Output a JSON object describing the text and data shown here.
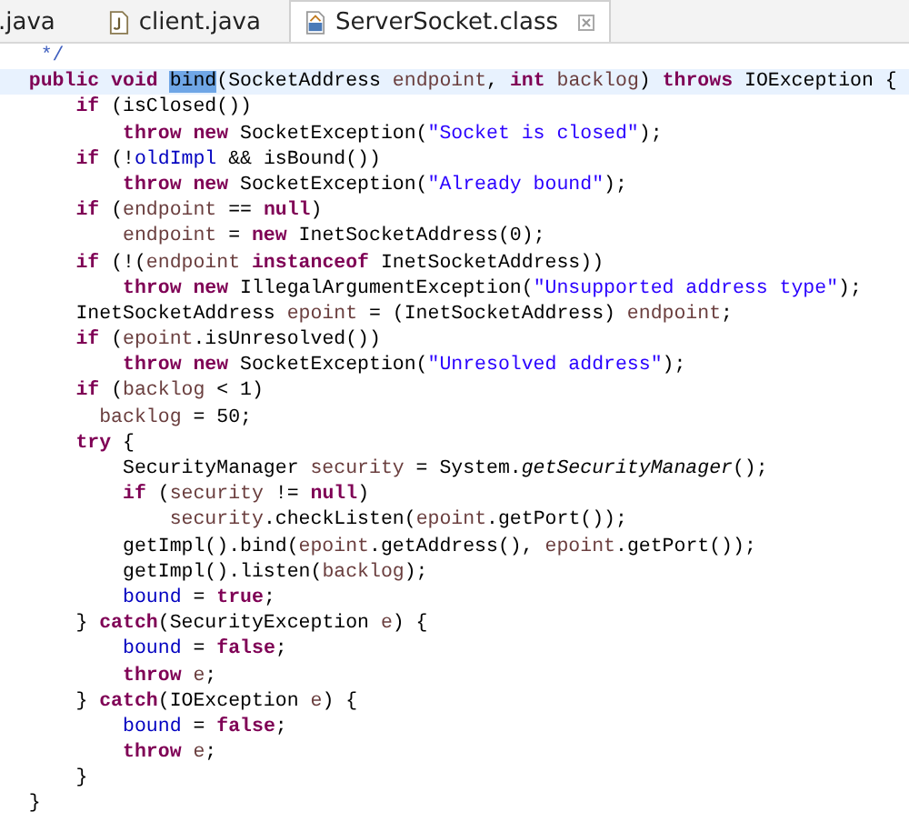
{
  "tabs": [
    {
      "label": ".java",
      "selected": false
    },
    {
      "label": "client.java",
      "kind": "java",
      "selected": false
    },
    {
      "label": "ServerSocket.class",
      "kind": "class",
      "selected": true
    }
  ],
  "code": [
    {
      "current": false,
      "segments": [
        {
          "kind": "comment",
          "text": "   */"
        }
      ]
    },
    {
      "current": true,
      "segments": [
        {
          "kind": "kw",
          "text": "  public void "
        },
        {
          "kind": "sel",
          "text": "bind"
        },
        {
          "kind": "plain",
          "text": "(SocketAddress "
        },
        {
          "kind": "var",
          "text": "endpoint"
        },
        {
          "kind": "plain",
          "text": ", "
        },
        {
          "kind": "kw",
          "text": "int "
        },
        {
          "kind": "var",
          "text": "backlog"
        },
        {
          "kind": "plain",
          "text": ") "
        },
        {
          "kind": "kw",
          "text": "throws "
        },
        {
          "kind": "plain",
          "text": "IOException {"
        }
      ]
    },
    {
      "current": false,
      "segments": [
        {
          "kind": "kw",
          "text": "      if "
        },
        {
          "kind": "plain",
          "text": "(isClosed())"
        }
      ]
    },
    {
      "current": false,
      "segments": [
        {
          "kind": "kw",
          "text": "          throw new "
        },
        {
          "kind": "plain",
          "text": "SocketException("
        },
        {
          "kind": "str",
          "text": "\"Socket is closed\""
        },
        {
          "kind": "plain",
          "text": ");"
        }
      ]
    },
    {
      "current": false,
      "segments": [
        {
          "kind": "kw",
          "text": "      if "
        },
        {
          "kind": "plain",
          "text": "(!"
        },
        {
          "kind": "field",
          "text": "oldImpl"
        },
        {
          "kind": "plain",
          "text": " && isBound())"
        }
      ]
    },
    {
      "current": false,
      "segments": [
        {
          "kind": "kw",
          "text": "          throw new "
        },
        {
          "kind": "plain",
          "text": "SocketException("
        },
        {
          "kind": "str",
          "text": "\"Already bound\""
        },
        {
          "kind": "plain",
          "text": ");"
        }
      ]
    },
    {
      "current": false,
      "segments": [
        {
          "kind": "kw",
          "text": "      if "
        },
        {
          "kind": "plain",
          "text": "("
        },
        {
          "kind": "var",
          "text": "endpoint"
        },
        {
          "kind": "plain",
          "text": " == "
        },
        {
          "kind": "kw",
          "text": "null"
        },
        {
          "kind": "plain",
          "text": ")"
        }
      ]
    },
    {
      "current": false,
      "segments": [
        {
          "kind": "var",
          "text": "          endpoint"
        },
        {
          "kind": "plain",
          "text": " = "
        },
        {
          "kind": "kw",
          "text": "new "
        },
        {
          "kind": "plain",
          "text": "InetSocketAddress(0);"
        }
      ]
    },
    {
      "current": false,
      "segments": [
        {
          "kind": "kw",
          "text": "      if "
        },
        {
          "kind": "plain",
          "text": "(!("
        },
        {
          "kind": "var",
          "text": "endpoint "
        },
        {
          "kind": "kw",
          "text": "instanceof "
        },
        {
          "kind": "plain",
          "text": "InetSocketAddress))"
        }
      ]
    },
    {
      "current": false,
      "segments": [
        {
          "kind": "kw",
          "text": "          throw new "
        },
        {
          "kind": "plain",
          "text": "IllegalArgumentException("
        },
        {
          "kind": "str",
          "text": "\"Unsupported address type\""
        },
        {
          "kind": "plain",
          "text": ");"
        }
      ]
    },
    {
      "current": false,
      "segments": [
        {
          "kind": "plain",
          "text": "      InetSocketAddress "
        },
        {
          "kind": "var",
          "text": "epoint"
        },
        {
          "kind": "plain",
          "text": " = (InetSocketAddress) "
        },
        {
          "kind": "var",
          "text": "endpoint"
        },
        {
          "kind": "plain",
          "text": ";"
        }
      ]
    },
    {
      "current": false,
      "segments": [
        {
          "kind": "kw",
          "text": "      if "
        },
        {
          "kind": "plain",
          "text": "("
        },
        {
          "kind": "var",
          "text": "epoint"
        },
        {
          "kind": "plain",
          "text": ".isUnresolved())"
        }
      ]
    },
    {
      "current": false,
      "segments": [
        {
          "kind": "kw",
          "text": "          throw new "
        },
        {
          "kind": "plain",
          "text": "SocketException("
        },
        {
          "kind": "str",
          "text": "\"Unresolved address\""
        },
        {
          "kind": "plain",
          "text": ");"
        }
      ]
    },
    {
      "current": false,
      "segments": [
        {
          "kind": "kw",
          "text": "      if "
        },
        {
          "kind": "plain",
          "text": "("
        },
        {
          "kind": "var",
          "text": "backlog"
        },
        {
          "kind": "plain",
          "text": " < 1)"
        }
      ]
    },
    {
      "current": false,
      "segments": [
        {
          "kind": "var",
          "text": "        backlog"
        },
        {
          "kind": "plain",
          "text": " = 50;"
        }
      ]
    },
    {
      "current": false,
      "segments": [
        {
          "kind": "kw",
          "text": "      try "
        },
        {
          "kind": "plain",
          "text": "{"
        }
      ]
    },
    {
      "current": false,
      "segments": [
        {
          "kind": "plain",
          "text": "          SecurityManager "
        },
        {
          "kind": "var",
          "text": "security"
        },
        {
          "kind": "plain",
          "text": " = System."
        },
        {
          "kind": "static",
          "text": "getSecurityManager"
        },
        {
          "kind": "plain",
          "text": "();"
        }
      ]
    },
    {
      "current": false,
      "segments": [
        {
          "kind": "kw",
          "text": "          if "
        },
        {
          "kind": "plain",
          "text": "("
        },
        {
          "kind": "var",
          "text": "security"
        },
        {
          "kind": "plain",
          "text": " != "
        },
        {
          "kind": "kw",
          "text": "null"
        },
        {
          "kind": "plain",
          "text": ")"
        }
      ]
    },
    {
      "current": false,
      "segments": [
        {
          "kind": "var",
          "text": "              security"
        },
        {
          "kind": "plain",
          "text": ".checkListen("
        },
        {
          "kind": "var",
          "text": "epoint"
        },
        {
          "kind": "plain",
          "text": ".getPort());"
        }
      ]
    },
    {
      "current": false,
      "segments": [
        {
          "kind": "plain",
          "text": "          getImpl().bind("
        },
        {
          "kind": "var",
          "text": "epoint"
        },
        {
          "kind": "plain",
          "text": ".getAddress(), "
        },
        {
          "kind": "var",
          "text": "epoint"
        },
        {
          "kind": "plain",
          "text": ".getPort());"
        }
      ]
    },
    {
      "current": false,
      "segments": [
        {
          "kind": "plain",
          "text": "          getImpl().listen("
        },
        {
          "kind": "var",
          "text": "backlog"
        },
        {
          "kind": "plain",
          "text": ");"
        }
      ]
    },
    {
      "current": false,
      "segments": [
        {
          "kind": "field",
          "text": "          bound"
        },
        {
          "kind": "plain",
          "text": " = "
        },
        {
          "kind": "kw",
          "text": "true"
        },
        {
          "kind": "plain",
          "text": ";"
        }
      ]
    },
    {
      "current": false,
      "segments": [
        {
          "kind": "plain",
          "text": "      } "
        },
        {
          "kind": "kw",
          "text": "catch"
        },
        {
          "kind": "plain",
          "text": "(SecurityException "
        },
        {
          "kind": "var",
          "text": "e"
        },
        {
          "kind": "plain",
          "text": ") {"
        }
      ]
    },
    {
      "current": false,
      "segments": [
        {
          "kind": "field",
          "text": "          bound"
        },
        {
          "kind": "plain",
          "text": " = "
        },
        {
          "kind": "kw",
          "text": "false"
        },
        {
          "kind": "plain",
          "text": ";"
        }
      ]
    },
    {
      "current": false,
      "segments": [
        {
          "kind": "kw",
          "text": "          throw "
        },
        {
          "kind": "var",
          "text": "e"
        },
        {
          "kind": "plain",
          "text": ";"
        }
      ]
    },
    {
      "current": false,
      "segments": [
        {
          "kind": "plain",
          "text": "      } "
        },
        {
          "kind": "kw",
          "text": "catch"
        },
        {
          "kind": "plain",
          "text": "(IOException "
        },
        {
          "kind": "var",
          "text": "e"
        },
        {
          "kind": "plain",
          "text": ") {"
        }
      ]
    },
    {
      "current": false,
      "segments": [
        {
          "kind": "field",
          "text": "          bound"
        },
        {
          "kind": "plain",
          "text": " = "
        },
        {
          "kind": "kw",
          "text": "false"
        },
        {
          "kind": "plain",
          "text": ";"
        }
      ]
    },
    {
      "current": false,
      "segments": [
        {
          "kind": "kw",
          "text": "          throw "
        },
        {
          "kind": "var",
          "text": "e"
        },
        {
          "kind": "plain",
          "text": ";"
        }
      ]
    },
    {
      "current": false,
      "segments": [
        {
          "kind": "plain",
          "text": "      }"
        }
      ]
    },
    {
      "current": false,
      "segments": [
        {
          "kind": "plain",
          "text": "  }"
        }
      ]
    }
  ]
}
